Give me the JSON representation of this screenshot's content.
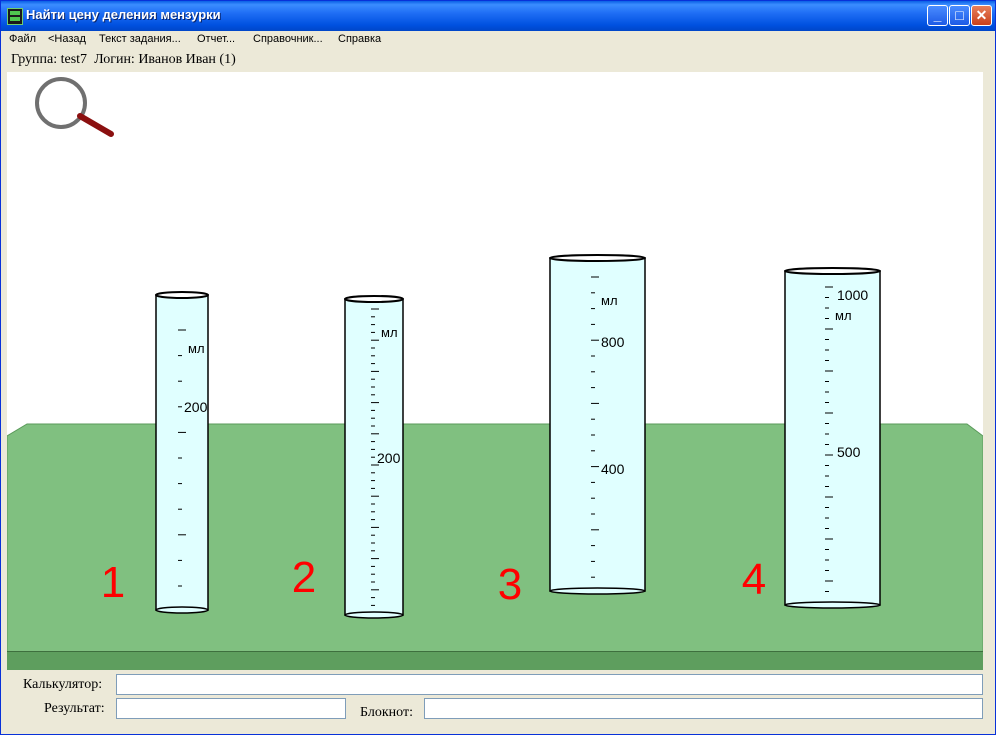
{
  "window": {
    "title": "Найти цену деления мензурки",
    "buttons": {
      "minimize": "_",
      "maximize": "□",
      "close": "✕"
    }
  },
  "menu": [
    "Файл",
    "<Назад",
    "Текст задания...",
    "Отчет...",
    "Справочник...",
    "Справка"
  ],
  "info": {
    "group": "Группа: test7",
    "login": "Логин: Иванов Иван (1)"
  },
  "magnifier_icon": "magnifier-icon",
  "colors": {
    "table": "#80c080",
    "liquid": "#e0ffff",
    "number": "#ff0000"
  },
  "cylinders": [
    {
      "number": "1",
      "unit": "мл",
      "labels": [
        "200"
      ]
    },
    {
      "number": "2",
      "unit": "мл",
      "labels": [
        "200"
      ]
    },
    {
      "number": "3",
      "unit": "мл",
      "labels": [
        "800",
        "400"
      ]
    },
    {
      "number": "4",
      "unit": "мл",
      "labels": [
        "1000",
        "500"
      ]
    }
  ],
  "bottom": {
    "calculator_label": "Калькулятор:",
    "calculator_value": "",
    "result_label": "Результат:",
    "result_value": "",
    "notepad_label": "Блокнот:",
    "notepad_value": ""
  }
}
